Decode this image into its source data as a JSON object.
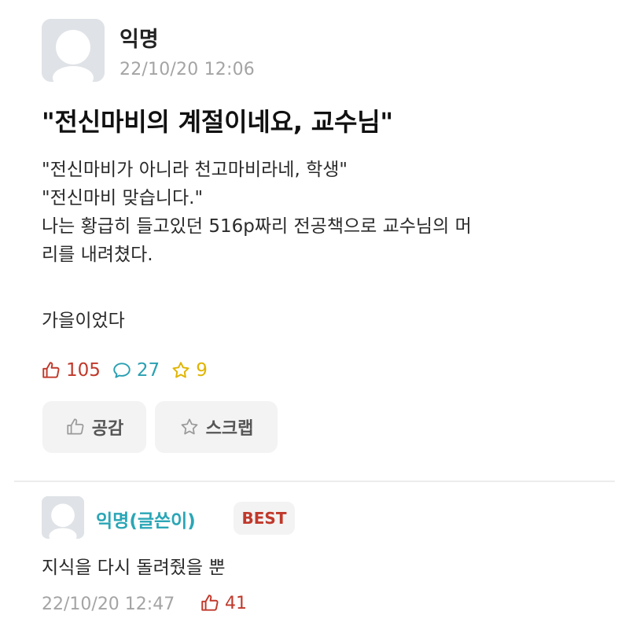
{
  "post": {
    "author": "익명",
    "timestamp": "22/10/20 12:06",
    "title": "\"전신마비의 계절이네요, 교수님\"",
    "body_lines": [
      "\"전신마비가 아니라 천고마비라네, 학생\"",
      "\"전신마비 맞습니다.\"",
      "나는 황급히 들고있던 516p짜리 전공책으로 교수님의 머",
      "리를 내려쳤다.",
      "가을이었다"
    ],
    "stats": {
      "likes": "105",
      "comments": "27",
      "scraps": "9"
    },
    "actions": {
      "like_label": "공감",
      "scrap_label": "스크랩"
    }
  },
  "comment": {
    "author": "익명(글쓴이)",
    "badge": "BEST",
    "text": "지식을 다시 돌려줬을 뿐",
    "timestamp": "22/10/20 12:47",
    "likes": "41"
  },
  "colors": {
    "like": "#c0392b",
    "comment": "#2a9fb2",
    "scrap": "#e0b400",
    "author_highlight": "#2aa6b6",
    "muted": "#a4a4a4"
  },
  "icons": {
    "avatar": "default-avatar-icon",
    "like": "thumbs-up-icon",
    "comment": "speech-bubble-icon",
    "scrap": "star-icon"
  }
}
